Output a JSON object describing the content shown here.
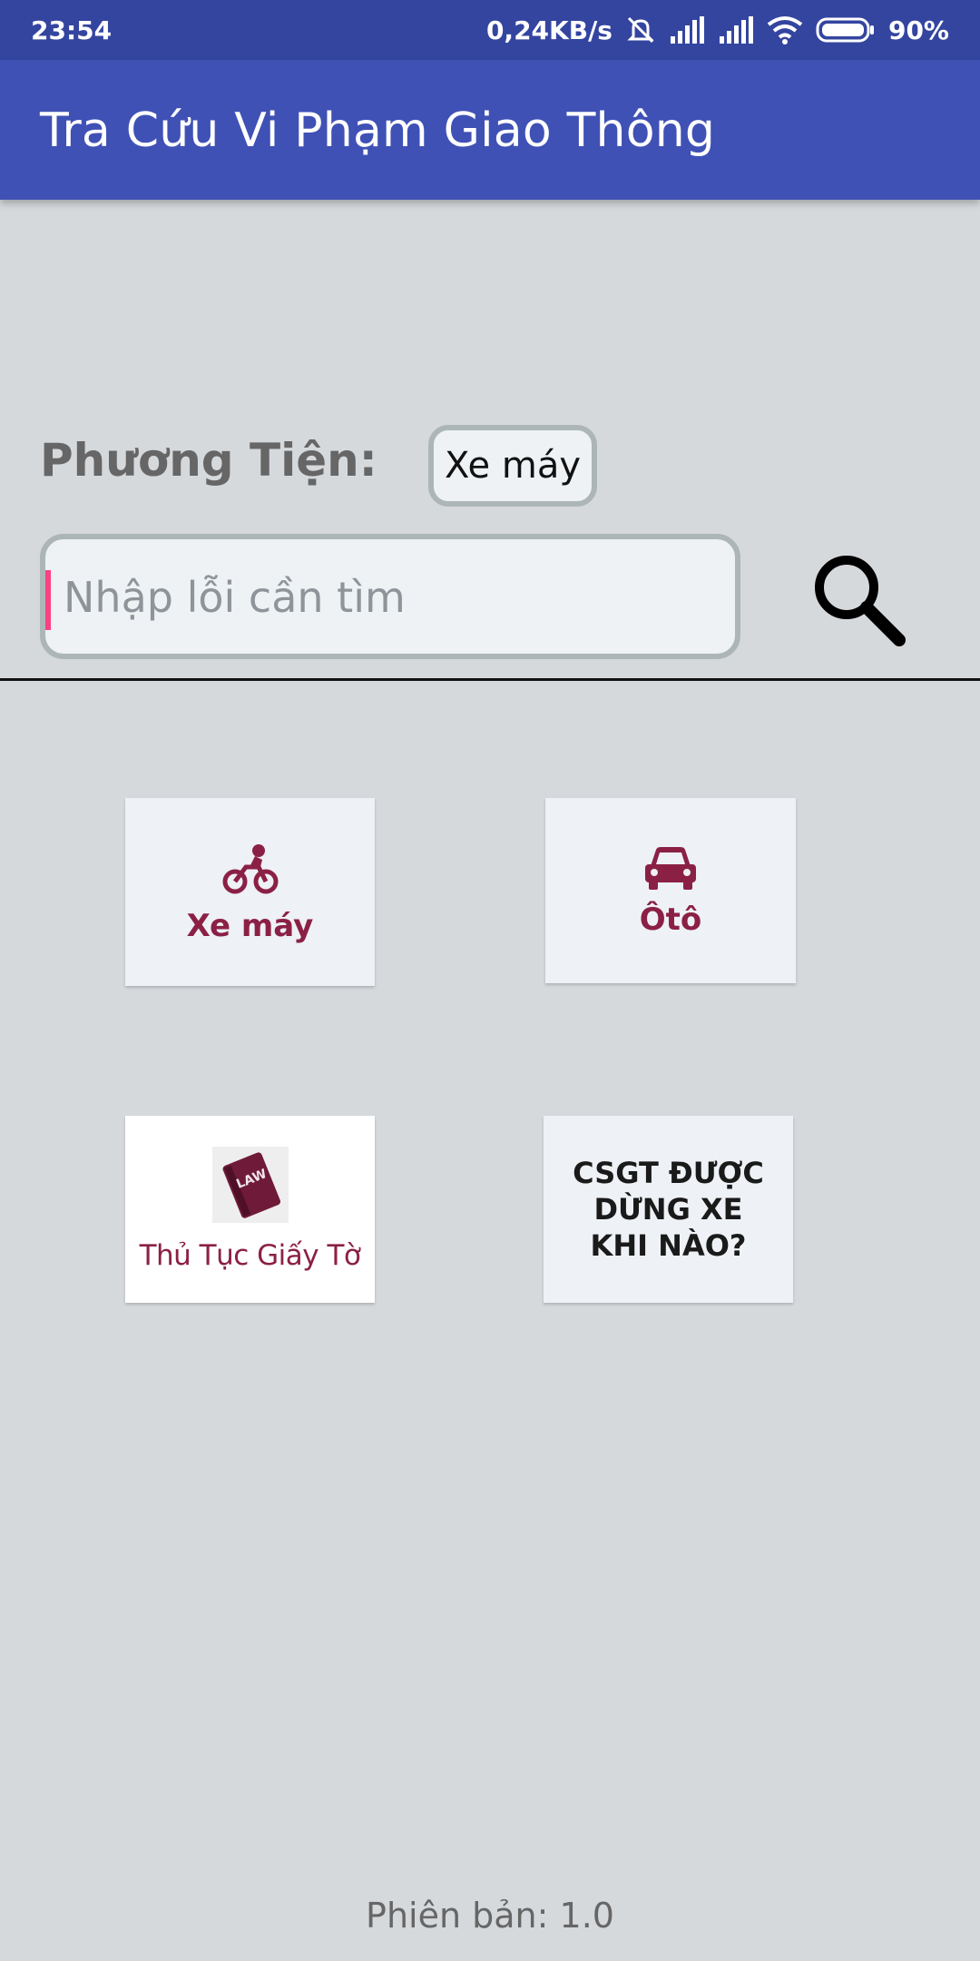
{
  "status_bar": {
    "time": "23:54",
    "net_speed": "0,24KB/s",
    "battery": "90%",
    "icons": [
      "mute-icon",
      "signal-icon",
      "signal-icon",
      "wifi-icon",
      "battery-icon"
    ]
  },
  "app_bar": {
    "title": "Tra Cứu Vi Phạm Giao Thông",
    "color": "#3f51b5"
  },
  "vehicle": {
    "label": "Phương Tiện:",
    "selected": "Xe máy"
  },
  "search": {
    "placeholder": "Nhập lỗi cần tìm",
    "value": "",
    "icon": "search-icon"
  },
  "tiles": [
    {
      "label": "Xe máy",
      "icon": "motorbike-icon"
    },
    {
      "label": "Ôtô",
      "icon": "car-icon"
    },
    {
      "label": "Thủ Tục Giấy Tờ",
      "icon": "law-book-icon",
      "icon_text": "LAW"
    },
    {
      "label": "CSGT ĐƯỢC DỪNG XE KHI NÀO?"
    }
  ],
  "accent_colors": {
    "maroon": "#8b2045",
    "cursor": "#ff4081"
  },
  "footer": {
    "version": "Phiên bản: 1.0"
  }
}
